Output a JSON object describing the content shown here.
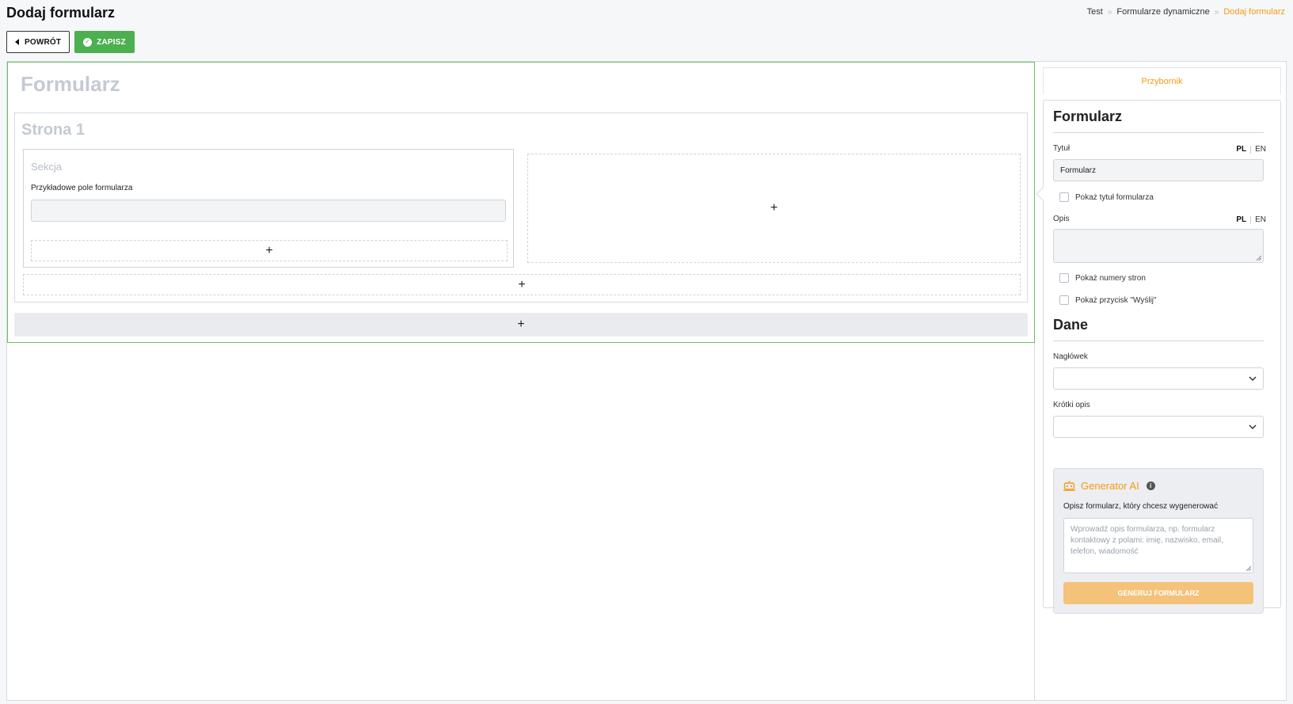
{
  "header": {
    "title": "Dodaj formularz",
    "breadcrumb": [
      "Test",
      "Formularze dynamiczne",
      "Dodaj formularz"
    ]
  },
  "toolbar": {
    "back_label": "POWRÓT",
    "save_label": "ZAPISZ"
  },
  "canvas": {
    "form_title": "Formularz",
    "page_title": "Strona 1",
    "section_title": "Sekcja",
    "sample_field_label": "Przykładowe pole formularza",
    "add_symbol": "+"
  },
  "sidebar": {
    "tab_label": "Przybornik",
    "form_heading": "Formularz",
    "title_label": "Tytuł",
    "lang_pl": "PL",
    "lang_en": "EN",
    "title_value": "Formularz",
    "show_title_label": "Pokaż tytuł formularza",
    "description_label": "Opis",
    "description_value": "",
    "show_page_numbers_label": "Pokaż numery stron",
    "show_submit_label": "Pokaż przycisk \"Wyślij\"",
    "data_heading": "Dane",
    "header_label": "Nagłówek",
    "header_value": "",
    "short_desc_label": "Krótki opis",
    "short_desc_value": ""
  },
  "ai_generator": {
    "title": "Generator AI",
    "info_glyph": "i",
    "prompt_label": "Opisz formularz, który chcesz wygenerować",
    "placeholder": "Wprowadź opis formularza, np. formularz kontaktowy z polami: imię, nazwisko, email, telefon, wiadomość",
    "generate_label": "GENERUJ FORMULARZ"
  },
  "colors": {
    "accent": "#f39c12",
    "success": "#4caf50",
    "canvas_border": "#6bbf63"
  },
  "icons": {
    "back": "caret-left-icon",
    "save": "check-circle-icon",
    "ai": "robot-icon",
    "info": "info-icon",
    "select": "chevron-down-icon"
  }
}
